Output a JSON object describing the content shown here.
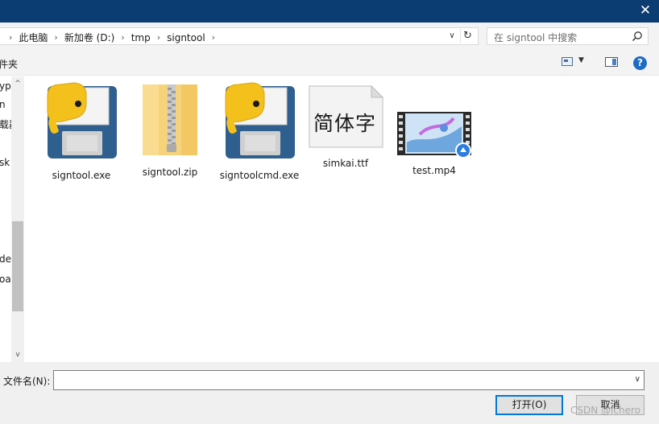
{
  "titlebar": {
    "close_glyph": "✕"
  },
  "address": {
    "crumbs": [
      "此电脑",
      "新加卷 (D:)",
      "tmp",
      "signtool"
    ],
    "separator": "›",
    "dropdown_glyph": "∨",
    "refresh_glyph": "↻"
  },
  "search": {
    "placeholder": "在 signtool 中搜索",
    "icon": "search-icon"
  },
  "toolbar": {
    "new_folder_label": "件夹",
    "dropdown_glyph": "▼",
    "help_glyph": "?"
  },
  "nav": {
    "items": [
      "yp",
      "n",
      "载器",
      "sk",
      "des",
      "oa"
    ],
    "up_glyph": "^",
    "down_glyph": "v"
  },
  "files": [
    {
      "name": "signtool.exe",
      "icon": "python-exe-icon"
    },
    {
      "name": "signtool.zip",
      "icon": "zip-folder-icon"
    },
    {
      "name": "signtoolcmd.exe",
      "icon": "python-exe-icon"
    },
    {
      "name": "simkai.ttf",
      "icon": "font-file-icon",
      "preview_text": "简体字"
    },
    {
      "name": "test.mp4",
      "icon": "video-file-icon"
    }
  ],
  "footer": {
    "filename_label": "文件名(N):",
    "filename_value": "",
    "open_label": "打开(O)",
    "cancel_label": "取消",
    "watermark": "CSDN @ichero"
  },
  "colors": {
    "titlebar": "#0b3c72",
    "accent": "#0078d7"
  }
}
